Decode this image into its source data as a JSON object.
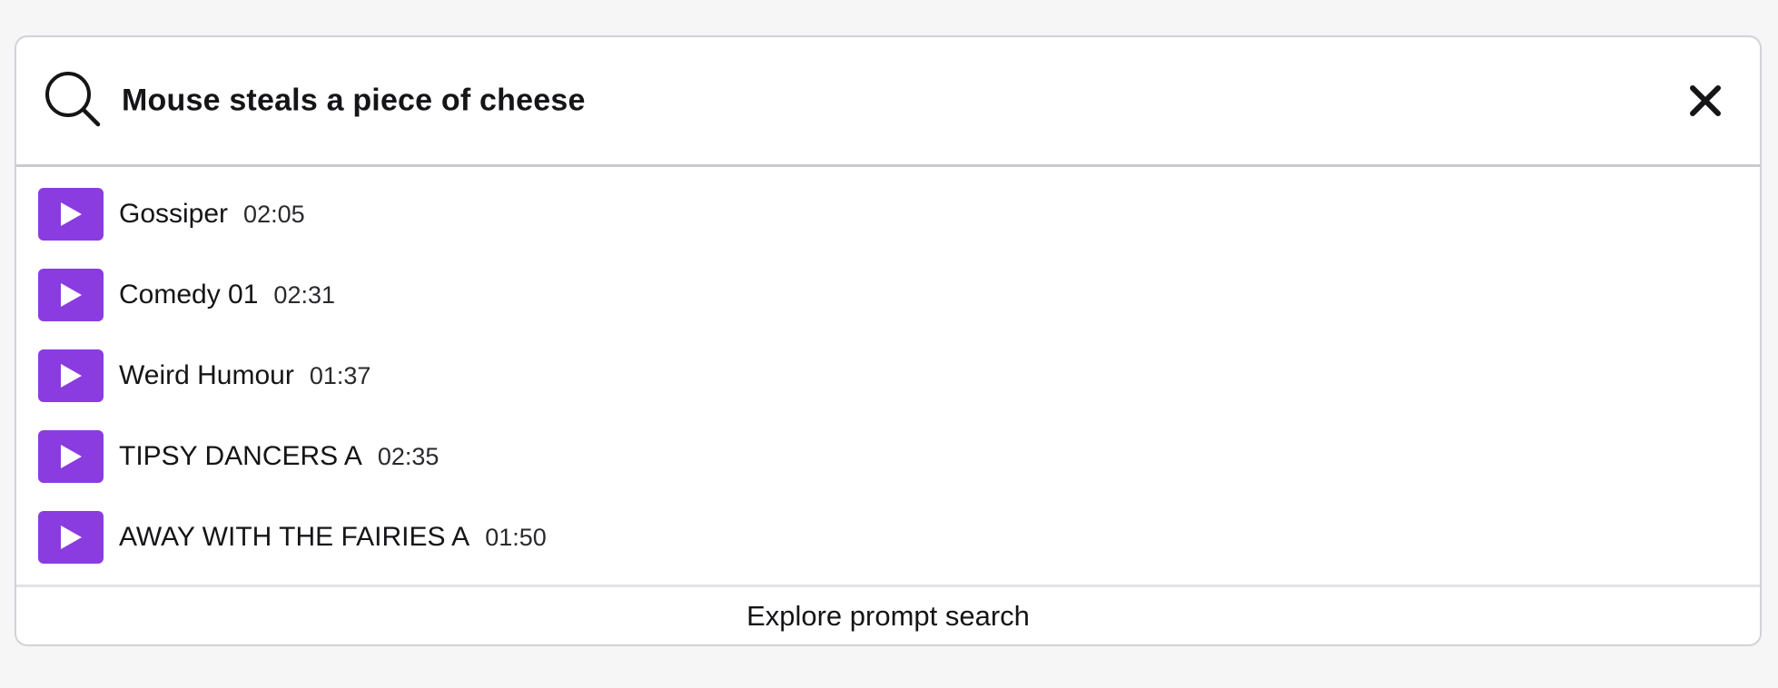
{
  "search": {
    "query": "Mouse steals a piece of cheese",
    "icon": "search-icon",
    "close_icon": "close-icon"
  },
  "results": [
    {
      "title": "Gossiper",
      "duration": "02:05"
    },
    {
      "title": "Comedy 01",
      "duration": "02:31"
    },
    {
      "title": "Weird Humour",
      "duration": "01:37"
    },
    {
      "title": "TIPSY DANCERS A",
      "duration": "02:35"
    },
    {
      "title": "AWAY WITH THE FAIRIES A",
      "duration": "01:50"
    }
  ],
  "footer": {
    "link_label": "Explore prompt search"
  },
  "colors": {
    "accent": "#8A3CE0",
    "text": "#151518",
    "border": "#D2D2D8"
  }
}
